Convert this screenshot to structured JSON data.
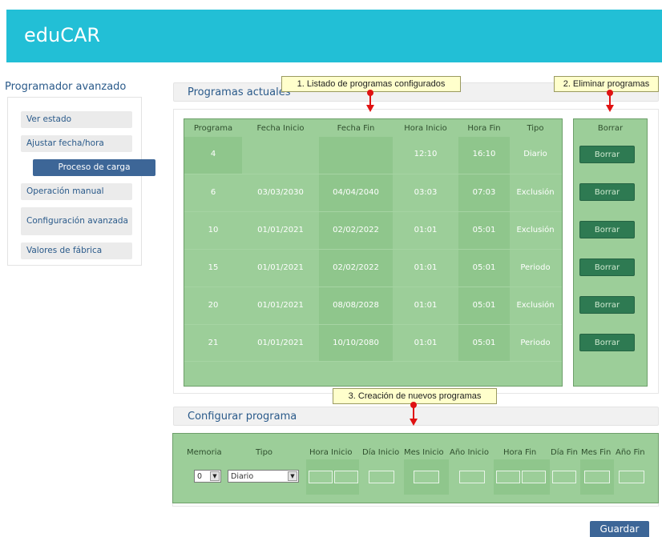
{
  "app": {
    "title": "eduCAR"
  },
  "sidebar": {
    "title": "Programador avanzado",
    "items": [
      {
        "label": "Ver estado"
      },
      {
        "label": "Ajustar fecha/hora"
      },
      {
        "label": "Proceso de carga"
      },
      {
        "label": "Operación manual"
      },
      {
        "label": "Configuración avanzada"
      },
      {
        "label": "Valores de fábrica"
      }
    ]
  },
  "programs": {
    "section_title": "Programas actuales",
    "columns": [
      "Programa",
      "Fecha Inicio",
      "Fecha Fin",
      "Hora Inicio",
      "Hora Fin",
      "Tipo"
    ],
    "delete_column": "Borrar",
    "delete_label": "Borrar",
    "rows": [
      {
        "programa": "4",
        "fecha_inicio": "",
        "fecha_fin": "",
        "hora_inicio": "12:10",
        "hora_fin": "16:10",
        "tipo": "Diario"
      },
      {
        "programa": "6",
        "fecha_inicio": "03/03/2030",
        "fecha_fin": "04/04/2040",
        "hora_inicio": "03:03",
        "hora_fin": "07:03",
        "tipo": "Exclusión"
      },
      {
        "programa": "10",
        "fecha_inicio": "01/01/2021",
        "fecha_fin": "02/02/2022",
        "hora_inicio": "01:01",
        "hora_fin": "05:01",
        "tipo": "Exclusión"
      },
      {
        "programa": "15",
        "fecha_inicio": "01/01/2021",
        "fecha_fin": "02/02/2022",
        "hora_inicio": "01:01",
        "hora_fin": "05:01",
        "tipo": "Periodo"
      },
      {
        "programa": "20",
        "fecha_inicio": "01/01/2021",
        "fecha_fin": "08/08/2028",
        "hora_inicio": "01:01",
        "hora_fin": "05:01",
        "tipo": "Exclusión"
      },
      {
        "programa": "21",
        "fecha_inicio": "01/01/2021",
        "fecha_fin": "10/10/2080",
        "hora_inicio": "01:01",
        "hora_fin": "05:01",
        "tipo": "Periodo"
      }
    ]
  },
  "config": {
    "section_title": "Configurar programa",
    "columns": [
      "Memoria",
      "Tipo",
      "Hora Inicio",
      "Día Inicio",
      "Mes Inicio",
      "Año Inicio",
      "Hora Fin",
      "Día Fin",
      "Mes Fin",
      "Año Fin"
    ],
    "memoria_value": "0",
    "tipo_value": "Diario"
  },
  "callouts": {
    "list": "1. Listado de programas configurados",
    "delete": "2. Eliminar programas",
    "create": "3. Creación de nuevos programas"
  },
  "save_label": "Guardar",
  "colors": {
    "header": "#22bfd6",
    "table_green": "#9cce99",
    "delete_button": "#2e7a52",
    "nav_active": "#3d6697",
    "callout_arrow": "#e01212"
  }
}
